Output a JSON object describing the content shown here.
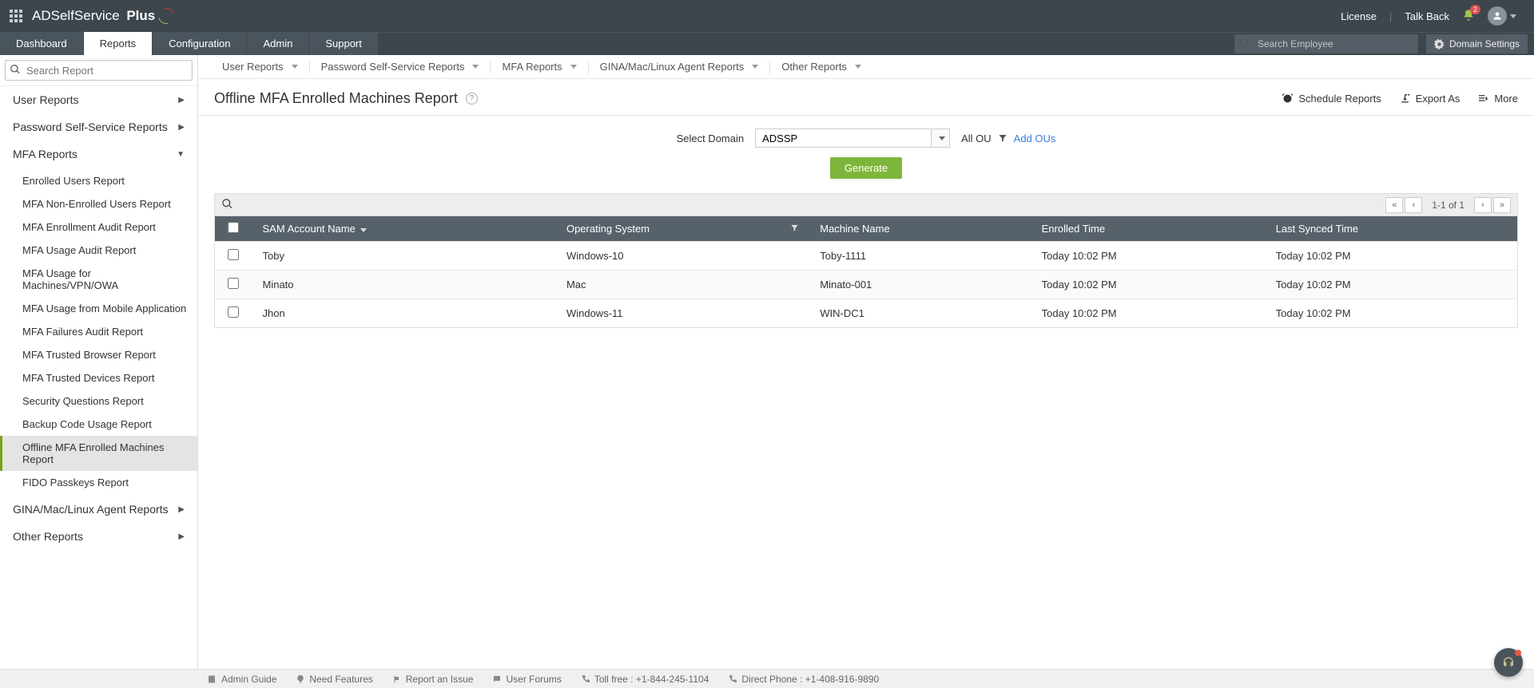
{
  "header": {
    "product_a": "ADSelfService",
    "product_b": "Plus",
    "license": "License",
    "talkback": "Talk Back",
    "notif_count": "2",
    "search_placeholder": "Search Employee",
    "domain_settings": "Domain Settings"
  },
  "nav": {
    "dashboard": "Dashboard",
    "reports": "Reports",
    "configuration": "Configuration",
    "admin": "Admin",
    "support": "Support"
  },
  "sidebar": {
    "search_placeholder": "Search Report",
    "cats": {
      "user_reports": "User Reports",
      "pss_reports": "Password Self-Service Reports",
      "mfa_reports": "MFA Reports",
      "gina_reports": "GINA/Mac/Linux Agent Reports",
      "other_reports": "Other Reports"
    },
    "mfa_items": [
      "Enrolled Users Report",
      "MFA Non-Enrolled Users Report",
      "MFA Enrollment Audit Report",
      "MFA Usage Audit Report",
      "MFA Usage for Machines/VPN/OWA",
      "MFA Usage from Mobile Application",
      "MFA Failures Audit Report",
      "MFA Trusted Browser Report",
      "MFA Trusted Devices Report",
      "Security Questions Report",
      "Backup Code Usage Report",
      "Offline MFA Enrolled Machines Report",
      "FIDO Passkeys Report"
    ]
  },
  "subnav": {
    "user_reports": "User Reports",
    "pss_reports": "Password Self-Service Reports",
    "mfa_reports": "MFA Reports",
    "gina_reports": "GINA/Mac/Linux Agent Reports",
    "other_reports": "Other Reports"
  },
  "page": {
    "title": "Offline MFA Enrolled Machines Report",
    "schedule": "Schedule Reports",
    "export": "Export As",
    "more": "More"
  },
  "filters": {
    "select_domain_label": "Select Domain",
    "domain_value": "ADSSP",
    "all_ou": "All OU",
    "add_ous": "Add OUs",
    "generate": "Generate"
  },
  "table": {
    "pager": "1-1 of 1",
    "cols": {
      "sam": "SAM Account Name",
      "os": "Operating System",
      "machine": "Machine Name",
      "enrolled": "Enrolled Time",
      "synced": "Last Synced Time"
    },
    "rows": [
      {
        "sam": "Toby",
        "os": "Windows-10",
        "machine": "Toby-1111",
        "enrolled": "Today 10:02 PM",
        "synced": "Today 10:02 PM"
      },
      {
        "sam": "Minato",
        "os": "Mac",
        "machine": "Minato-001",
        "enrolled": "Today 10:02 PM",
        "synced": "Today 10:02 PM"
      },
      {
        "sam": "Jhon",
        "os": "Windows-11",
        "machine": "WIN-DC1",
        "enrolled": "Today 10:02 PM",
        "synced": "Today 10:02 PM"
      }
    ]
  },
  "footer": {
    "admin_guide": "Admin Guide",
    "need_features": "Need Features",
    "report_issue": "Report an Issue",
    "user_forums": "User Forums",
    "tollfree": "Toll free : +1-844-245-1104",
    "direct": "Direct Phone : +1-408-916-9890"
  }
}
